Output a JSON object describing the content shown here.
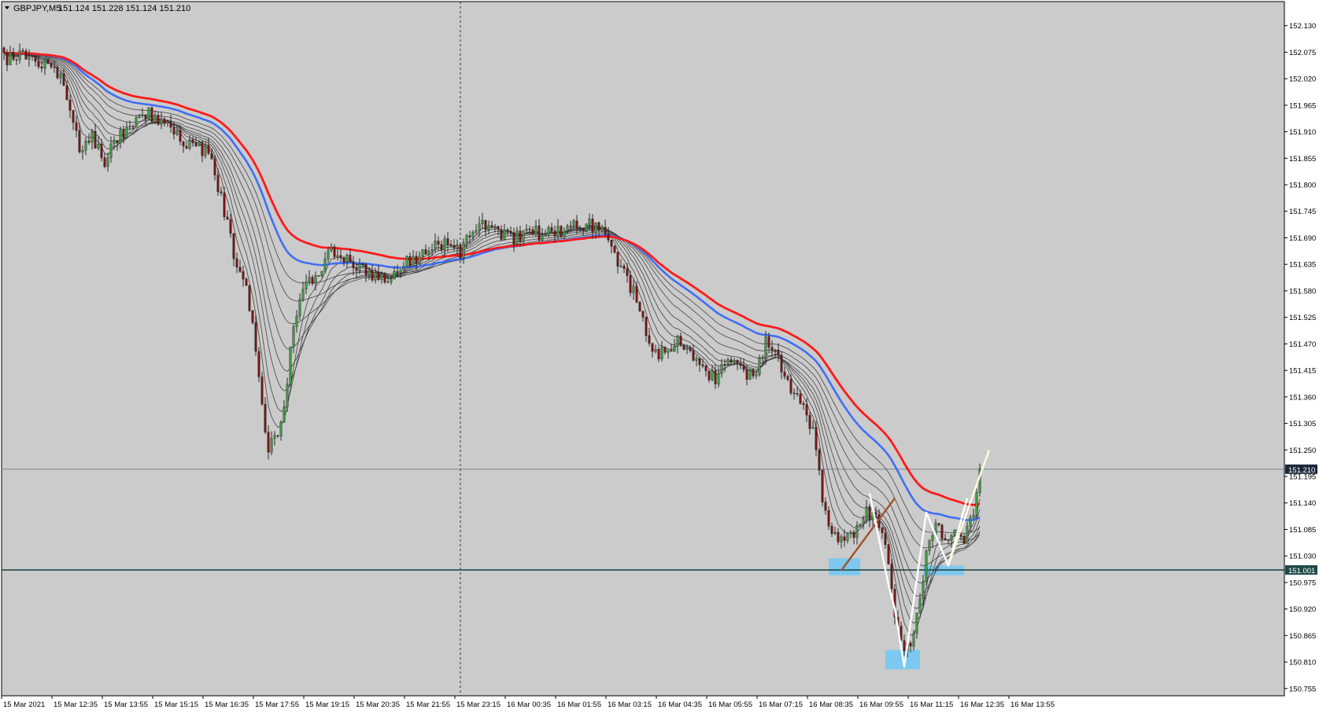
{
  "header": {
    "symbol_label": "GBPJPY,M5",
    "ohlc_label": "151.124 151.228 151.124 151.210"
  },
  "colors": {
    "background": "#cbcbcb",
    "frame": "#ffffff",
    "axis": "#000000",
    "bull_body": "#3f9a3f",
    "bear_body": "#7a1414",
    "ema_red": "#ff1a1a",
    "ema_blue": "#3f6ff5",
    "ema_grey": "#444444",
    "support_line": "#1f4a4a",
    "zone": "#7cc8f0",
    "pattern_w": "#ffffff",
    "pattern_break": "#fffbe0",
    "trend_brown": "#a0522d"
  },
  "chart_data": {
    "type": "candlestick",
    "symbol": "GBPJPY",
    "timeframe": "M5",
    "ylim": [
      150.74,
      152.18
    ],
    "y_ticks": [
      "152.130",
      "152.075",
      "152.020",
      "151.965",
      "151.910",
      "151.855",
      "151.800",
      "151.745",
      "151.690",
      "151.635",
      "151.580",
      "151.525",
      "151.470",
      "151.415",
      "151.360",
      "151.305",
      "151.250",
      "151.195",
      "151.140",
      "151.085",
      "151.030",
      "150.975",
      "150.920",
      "150.865",
      "150.810",
      "150.755"
    ],
    "x_ticks": [
      "15 Mar 2021",
      "15 Mar 12:35",
      "15 Mar 13:55",
      "15 Mar 15:15",
      "15 Mar 16:35",
      "15 Mar 17:55",
      "15 Mar 19:15",
      "15 Mar 20:35",
      "15 Mar 21:55",
      "15 Mar 23:15",
      "16 Mar 00:35",
      "16 Mar 01:55",
      "16 Mar 03:15",
      "16 Mar 04:35",
      "16 Mar 05:55",
      "16 Mar 07:15",
      "16 Mar 08:35",
      "16 Mar 09:55",
      "16 Mar 11:15",
      "16 Mar 12:35",
      "16 Mar 13:55"
    ],
    "price_anchors": [
      [
        0,
        152.06
      ],
      [
        6,
        152.07
      ],
      [
        12,
        152.05
      ],
      [
        18,
        152.03
      ],
      [
        20,
        151.98
      ],
      [
        24,
        151.88
      ],
      [
        28,
        151.9
      ],
      [
        32,
        151.85
      ],
      [
        35,
        151.88
      ],
      [
        40,
        151.93
      ],
      [
        45,
        151.95
      ],
      [
        50,
        151.93
      ],
      [
        55,
        151.9
      ],
      [
        60,
        151.88
      ],
      [
        65,
        151.87
      ],
      [
        68,
        151.8
      ],
      [
        71,
        151.72
      ],
      [
        74,
        151.62
      ],
      [
        77,
        151.6
      ],
      [
        80,
        151.45
      ],
      [
        84,
        151.25
      ],
      [
        88,
        151.3
      ],
      [
        92,
        151.5
      ],
      [
        96,
        151.6
      ],
      [
        100,
        151.62
      ],
      [
        104,
        151.66
      ],
      [
        110,
        151.64
      ],
      [
        116,
        151.62
      ],
      [
        122,
        151.6
      ],
      [
        128,
        151.64
      ],
      [
        134,
        151.66
      ],
      [
        140,
        151.68
      ],
      [
        145,
        151.66
      ],
      [
        150,
        151.72
      ],
      [
        156,
        151.7
      ],
      [
        162,
        151.69
      ],
      [
        168,
        151.7
      ],
      [
        174,
        151.7
      ],
      [
        180,
        151.71
      ],
      [
        186,
        151.72
      ],
      [
        190,
        151.7
      ],
      [
        194,
        151.65
      ],
      [
        198,
        151.6
      ],
      [
        202,
        151.55
      ],
      [
        206,
        151.45
      ],
      [
        210,
        151.45
      ],
      [
        214,
        151.48
      ],
      [
        218,
        151.45
      ],
      [
        222,
        151.42
      ],
      [
        226,
        151.4
      ],
      [
        230,
        151.43
      ],
      [
        234,
        151.42
      ],
      [
        238,
        151.4
      ],
      [
        242,
        151.47
      ],
      [
        246,
        151.44
      ],
      [
        250,
        151.38
      ],
      [
        254,
        151.35
      ],
      [
        258,
        151.26
      ],
      [
        260,
        151.15
      ],
      [
        263,
        151.07
      ],
      [
        266,
        151.06
      ],
      [
        270,
        151.08
      ],
      [
        274,
        151.12
      ],
      [
        278,
        151.1
      ],
      [
        280,
        151.06
      ],
      [
        282,
        150.95
      ],
      [
        284,
        150.87
      ],
      [
        286,
        150.84
      ],
      [
        288,
        150.84
      ],
      [
        291,
        150.95
      ],
      [
        293,
        151.03
      ],
      [
        296,
        151.09
      ],
      [
        299,
        151.06
      ],
      [
        302,
        151.08
      ],
      [
        305,
        151.06
      ],
      [
        308,
        151.12
      ],
      [
        310,
        151.21
      ]
    ],
    "y_lines": [
      {
        "label": "151.210",
        "value": 151.21
      },
      {
        "label": "151.001",
        "value": 151.001
      }
    ],
    "zones": [
      {
        "i0": 262,
        "i1": 272,
        "y0": 150.99,
        "y1": 151.025
      },
      {
        "i0": 280,
        "i1": 291,
        "y0": 150.795,
        "y1": 150.835
      },
      {
        "i0": 292,
        "i1": 305,
        "y0": 150.99,
        "y1": 151.01
      }
    ],
    "pattern_w": [
      [
        275,
        151.16
      ],
      [
        281,
        150.97
      ],
      [
        283,
        150.92
      ],
      [
        286,
        150.8
      ],
      [
        293,
        151.12
      ],
      [
        300,
        151.01
      ],
      [
        306,
        151.15
      ]
    ],
    "pattern_break": [
      [
        300,
        151.01
      ],
      [
        308,
        151.16
      ],
      [
        313,
        151.25
      ]
    ],
    "trend_brown": [
      [
        266,
        151.0
      ],
      [
        283,
        151.15
      ]
    ],
    "crosshair_index": 145,
    "ema_periods": [
      5,
      8,
      12,
      16,
      21,
      28,
      36,
      44
    ],
    "ema_blue_period": 55,
    "ema_red_period": 68
  }
}
